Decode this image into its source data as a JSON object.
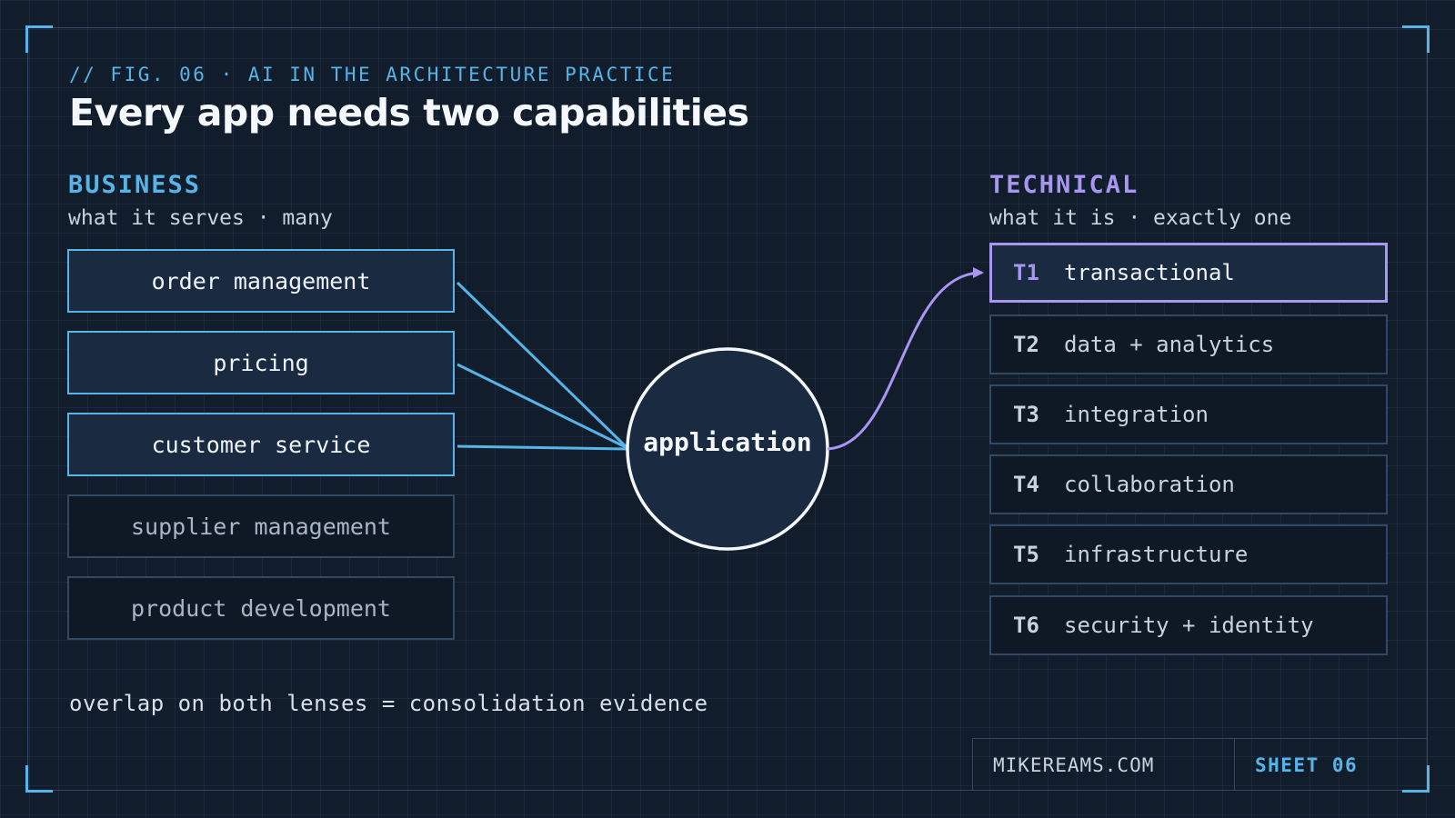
{
  "header": {
    "eyebrow": "// FIG. 06 · AI IN THE ARCHITECTURE PRACTICE",
    "title": "Every app needs two capabilities"
  },
  "business": {
    "heading": "BUSINESS",
    "subheading": "what it serves · many",
    "items": [
      {
        "label": "order management",
        "connected": true
      },
      {
        "label": "pricing",
        "connected": true
      },
      {
        "label": "customer service",
        "connected": true
      },
      {
        "label": "supplier management",
        "connected": false
      },
      {
        "label": "product development",
        "connected": false
      }
    ]
  },
  "center": {
    "label": "application"
  },
  "technical": {
    "heading": "TECHNICAL",
    "subheading": "what it is · exactly one",
    "items": [
      {
        "code": "T1",
        "label": "transactional",
        "selected": true
      },
      {
        "code": "T2",
        "label": "data + analytics",
        "selected": false
      },
      {
        "code": "T3",
        "label": "integration",
        "selected": false
      },
      {
        "code": "T4",
        "label": "collaboration",
        "selected": false
      },
      {
        "code": "T5",
        "label": "infrastructure",
        "selected": false
      },
      {
        "code": "T6",
        "label": "security + identity",
        "selected": false
      }
    ]
  },
  "footnote": "overlap on both lenses = consolidation evidence",
  "footer": {
    "site": "MIKEREAMS.COM",
    "sheet": "SHEET 06"
  },
  "colors": {
    "business_accent": "#56b4e8",
    "technical_accent": "#a896f0",
    "background": "#121d2b"
  }
}
